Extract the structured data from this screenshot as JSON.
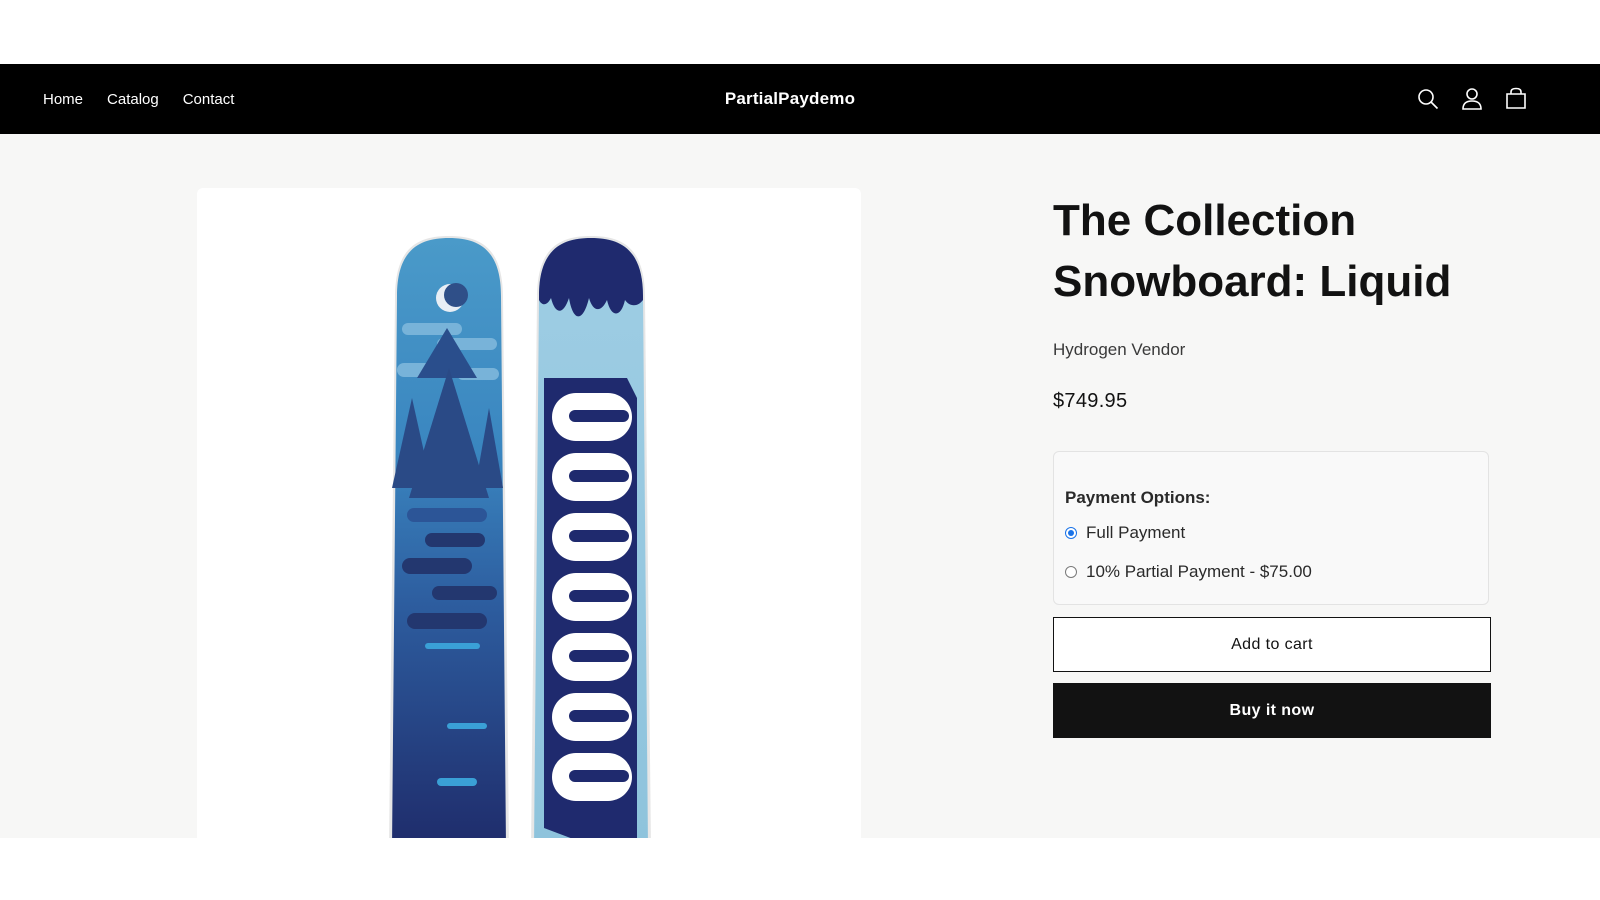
{
  "header": {
    "nav": [
      {
        "label": "Home"
      },
      {
        "label": "Catalog"
      },
      {
        "label": "Contact"
      }
    ],
    "brand": "PartialPaydemo",
    "icons": [
      "search-icon",
      "account-icon",
      "cart-icon"
    ]
  },
  "product": {
    "image_alt": "Liquid snowboard top and base graphics",
    "title": "The Collection Snowboard: Liquid",
    "vendor": "Hydrogen Vendor",
    "price": "$749.95"
  },
  "payment": {
    "title": "Payment Options:",
    "options": [
      {
        "label": "Full Payment",
        "checked": true
      },
      {
        "label": "10% Partial Payment - $75.00",
        "checked": false
      }
    ],
    "accent": "#1a73e8"
  },
  "buttons": {
    "add_to_cart": "Add to cart",
    "buy_now": "Buy it now"
  },
  "colors": {
    "header_bg": "#000000",
    "page_bg": "#f7f7f6",
    "button_dark": "#121212"
  }
}
